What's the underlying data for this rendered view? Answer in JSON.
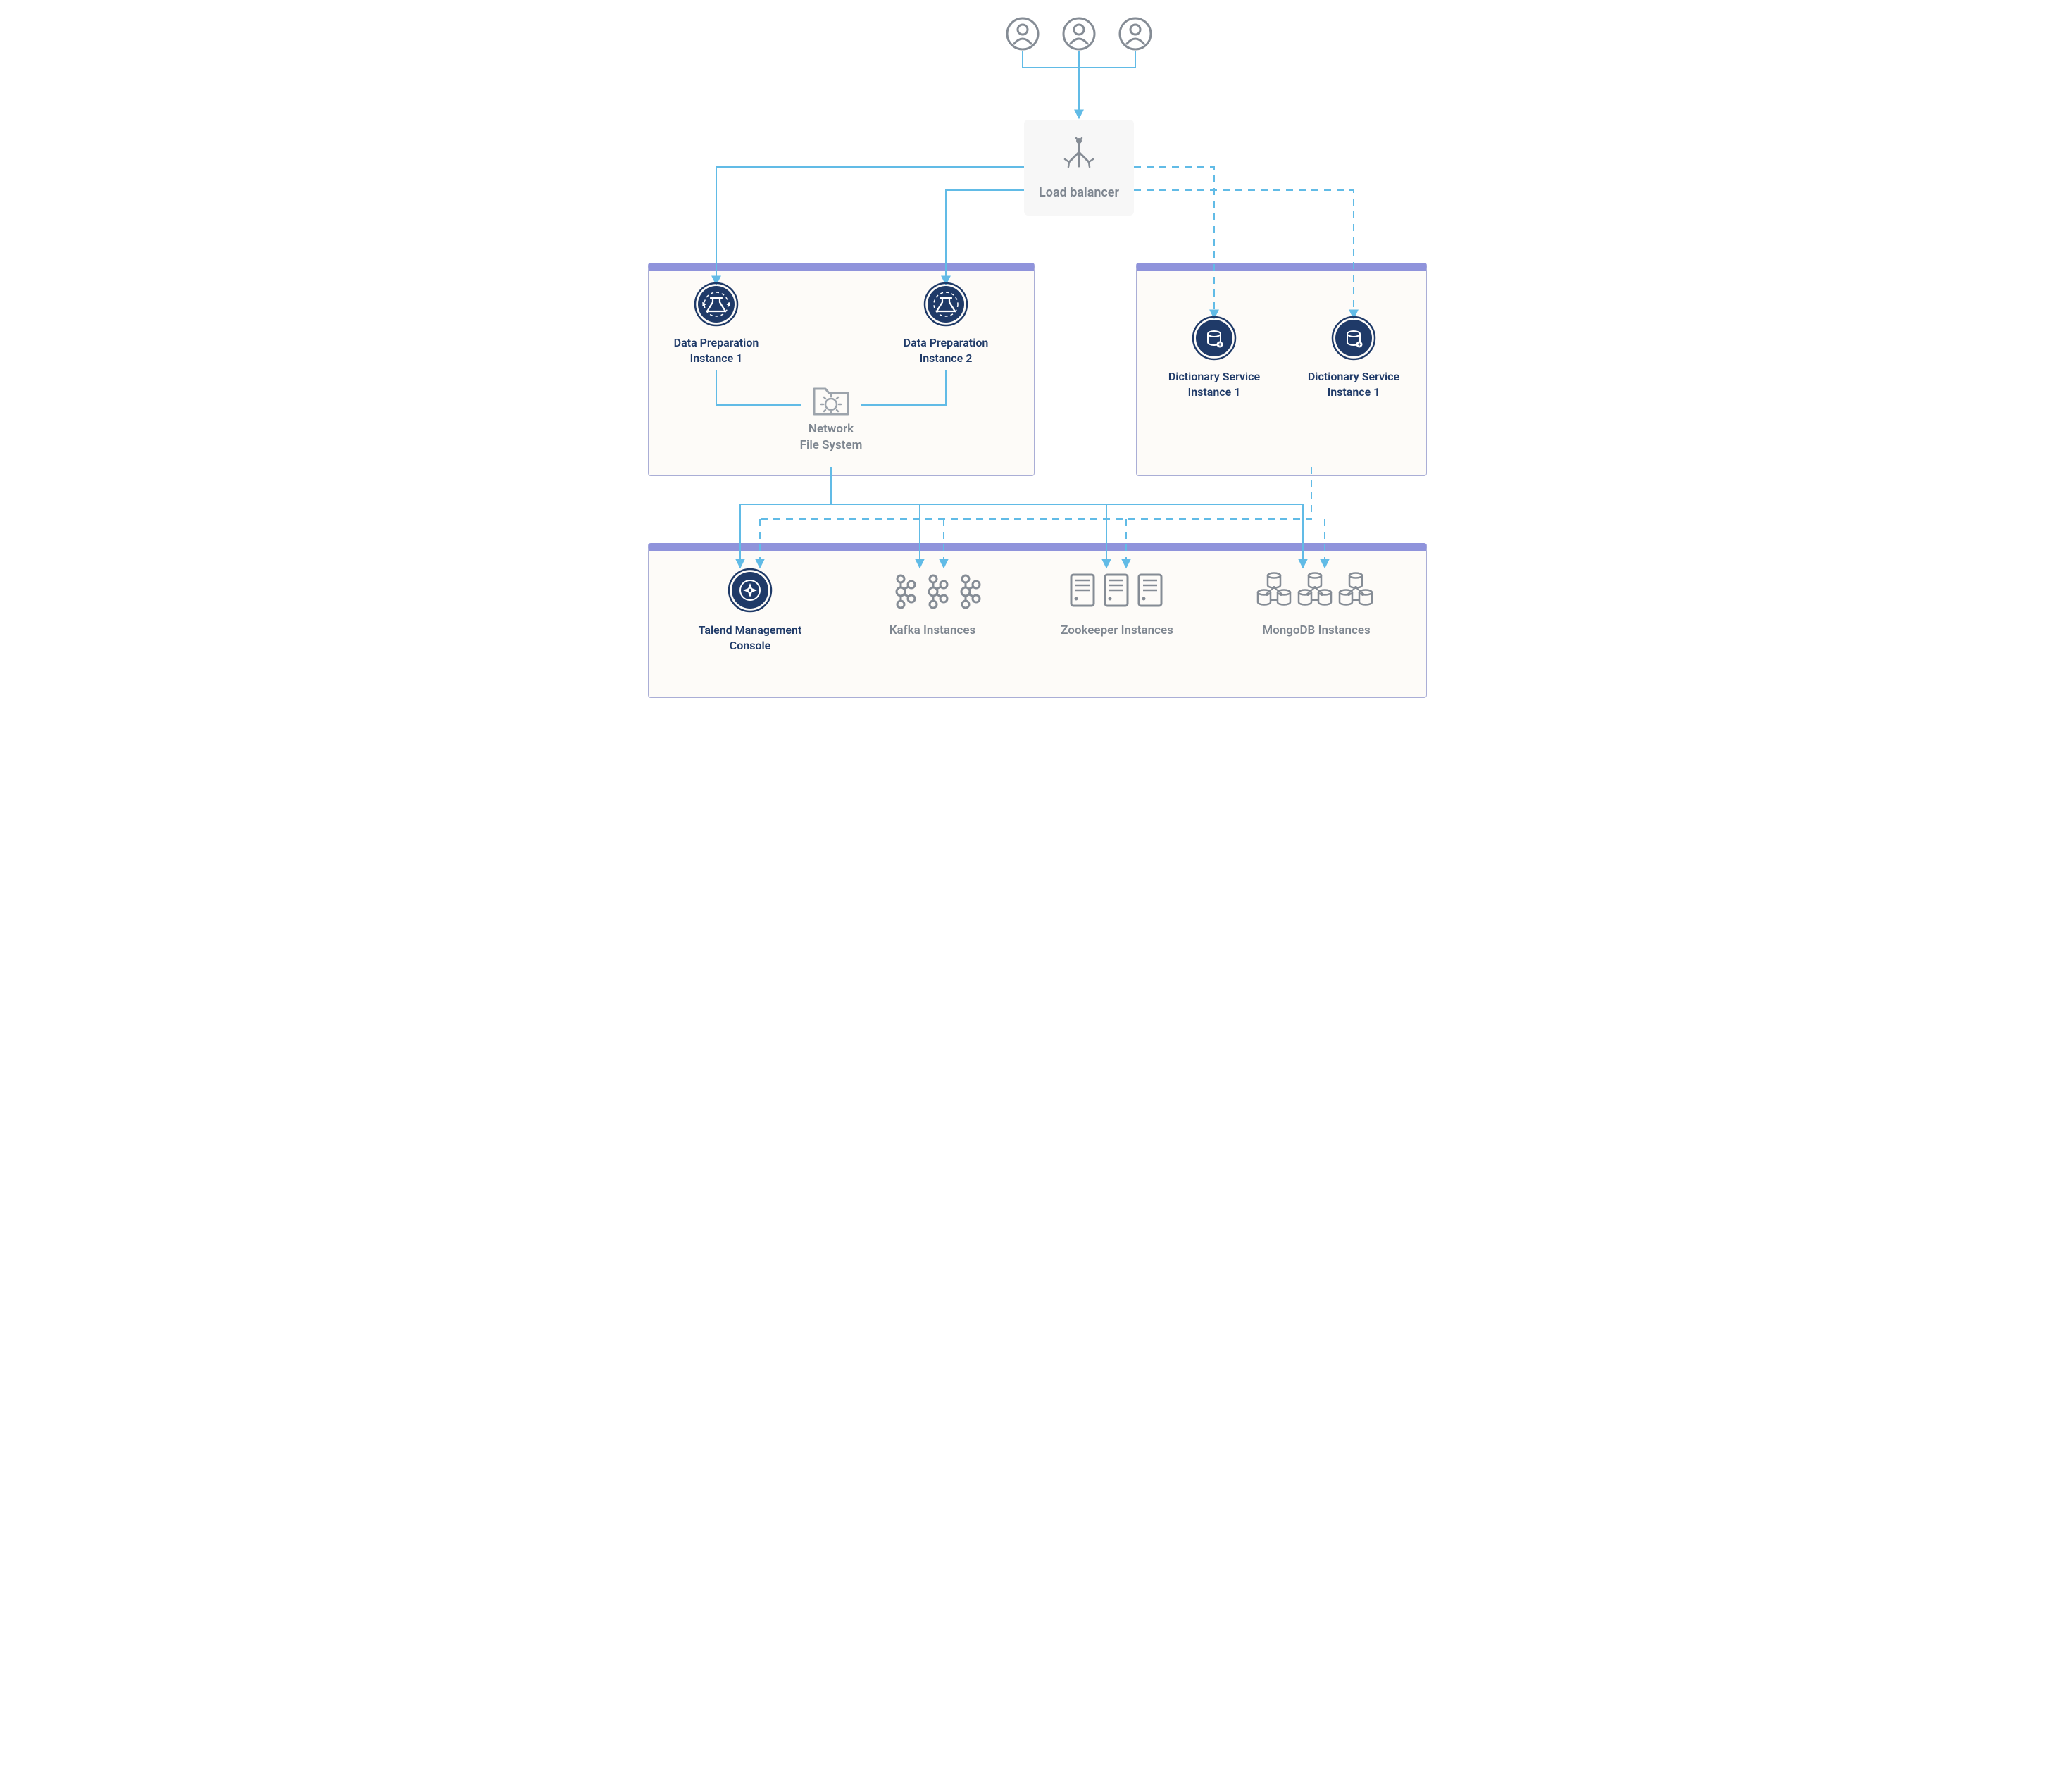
{
  "colors": {
    "connector": "#61bbe6",
    "loadBalancerFill": "#f7f7f7",
    "groupFill": "#fdfbf8",
    "groupBorder": "#aaaed6",
    "groupHeader": "#8f93db",
    "iconDark": "#1f3a68",
    "iconGray": "#858c95",
    "textGray": "#7e8690",
    "textNavy": "#1f3a68"
  },
  "labels": {
    "loadBalancer": "Load balancer",
    "dataPrep1": "Data Preparation\nInstance 1",
    "dataPrep2": "Data Preparation\nInstance 2",
    "nfs": "Network\nFile System",
    "dict1": "Dictionary Service\nInstance 1",
    "dict2": "Dictionary Service\nInstance 1",
    "tmc": "Talend Management\nConsole",
    "kafka": "Kafka Instances",
    "zookeeper": "Zookeeper Instances",
    "mongo": "MongoDB Instances"
  },
  "diagram": {
    "nodes": [
      {
        "id": "user1",
        "type": "user"
      },
      {
        "id": "user2",
        "type": "user"
      },
      {
        "id": "user3",
        "type": "user"
      },
      {
        "id": "lb",
        "type": "load-balancer",
        "labelKey": "loadBalancer"
      },
      {
        "id": "dp1",
        "type": "data-preparation",
        "labelKey": "dataPrep1"
      },
      {
        "id": "dp2",
        "type": "data-preparation",
        "labelKey": "dataPrep2"
      },
      {
        "id": "nfs",
        "type": "network-file-system",
        "labelKey": "nfs"
      },
      {
        "id": "ds1",
        "type": "dictionary-service",
        "labelKey": "dict1"
      },
      {
        "id": "ds2",
        "type": "dictionary-service",
        "labelKey": "dict2"
      },
      {
        "id": "tmc",
        "type": "talend-management-console",
        "labelKey": "tmc"
      },
      {
        "id": "kafka",
        "type": "kafka-cluster",
        "labelKey": "kafka"
      },
      {
        "id": "zk",
        "type": "zookeeper-cluster",
        "labelKey": "zookeeper"
      },
      {
        "id": "mongo",
        "type": "mongodb-cluster",
        "labelKey": "mongo"
      }
    ],
    "groups": [
      {
        "id": "g-dataprep",
        "contains": [
          "dp1",
          "dp2",
          "nfs"
        ]
      },
      {
        "id": "g-dict",
        "contains": [
          "ds1",
          "ds2"
        ]
      },
      {
        "id": "g-infra",
        "contains": [
          "tmc",
          "kafka",
          "zk",
          "mongo"
        ]
      }
    ],
    "edges": [
      {
        "from": "user1",
        "to": "lb",
        "style": "solid"
      },
      {
        "from": "user2",
        "to": "lb",
        "style": "solid"
      },
      {
        "from": "user3",
        "to": "lb",
        "style": "solid"
      },
      {
        "from": "lb",
        "to": "dp1",
        "style": "solid"
      },
      {
        "from": "lb",
        "to": "dp2",
        "style": "solid"
      },
      {
        "from": "lb",
        "to": "ds1",
        "style": "dashed"
      },
      {
        "from": "lb",
        "to": "ds2",
        "style": "dashed"
      },
      {
        "from": "dp1",
        "to": "nfs",
        "style": "solid"
      },
      {
        "from": "dp2",
        "to": "nfs",
        "style": "solid"
      },
      {
        "from": "g-dataprep",
        "to": "tmc",
        "style": "solid"
      },
      {
        "from": "g-dataprep",
        "to": "kafka",
        "style": "solid"
      },
      {
        "from": "g-dataprep",
        "to": "zk",
        "style": "solid"
      },
      {
        "from": "g-dataprep",
        "to": "mongo",
        "style": "solid"
      },
      {
        "from": "g-dict",
        "to": "tmc",
        "style": "dashed"
      },
      {
        "from": "g-dict",
        "to": "kafka",
        "style": "dashed"
      },
      {
        "from": "g-dict",
        "to": "zk",
        "style": "dashed"
      },
      {
        "from": "g-dict",
        "to": "mongo",
        "style": "dashed"
      }
    ]
  }
}
